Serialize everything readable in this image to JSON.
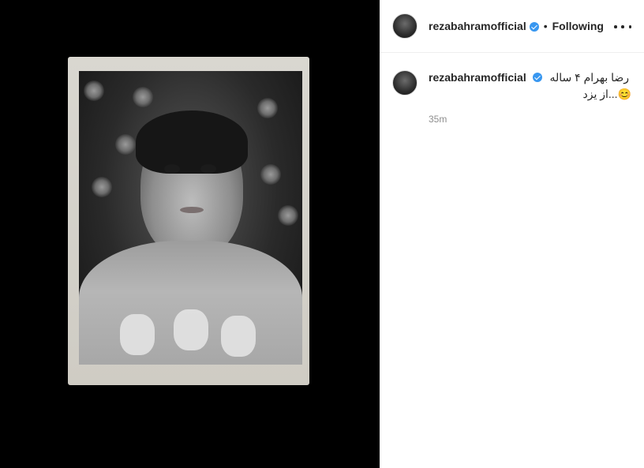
{
  "post": {
    "username": "rezabahramofficial",
    "verified": true,
    "separator": "•",
    "follow_label": "Following",
    "more_icon": "more-horizontal-icon",
    "caption_line1": "رضا بهرام ۴ ساله",
    "caption_line2": "😊...از یزد",
    "timestamp": "35m"
  },
  "colors": {
    "verified_badge": "#3897f0",
    "media_background": "#000000",
    "timestamp_text": "#8e8e8e"
  }
}
